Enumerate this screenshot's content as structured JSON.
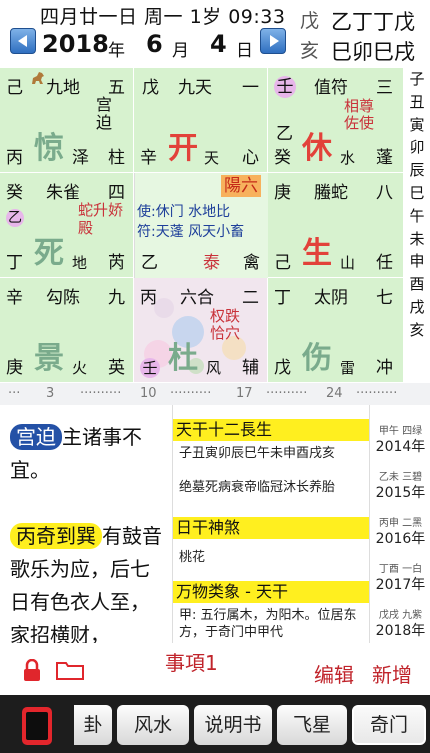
{
  "header": {
    "lunar_line": "四月廿一日 周一 1岁 09:33",
    "year": "2018",
    "year_unit": "年",
    "month": "6",
    "month_unit": "月",
    "day": "4",
    "day_unit": "日",
    "gz_top_label": "戊",
    "gz_top_value": "乙丁丁戊",
    "gz_bot_label": "亥",
    "gz_bot_value": "巳卯巳戌"
  },
  "palaces": {
    "p1": {
      "a": "己",
      "b": "九地",
      "c": "五",
      "note": "宫迫",
      "big": "惊",
      "d": "丙",
      "e": "泽",
      "f": "柱"
    },
    "p2": {
      "a": "戊",
      "b": "九天",
      "c": "一",
      "big": "开",
      "d": "辛",
      "e": "天",
      "f": "心"
    },
    "p3": {
      "a": "壬",
      "b": "值符",
      "c": "三",
      "note": "相尊佐使",
      "a2": "乙",
      "big": "休",
      "d": "癸",
      "e": "水",
      "f": "蓬"
    },
    "p4": {
      "a": "癸",
      "b": "朱雀",
      "c": "四",
      "a2": "乙",
      "note": "蛇升娇殿",
      "big": "死",
      "d": "丁",
      "e": "地",
      "f": "芮"
    },
    "p5": {
      "tag": "陽六",
      "l1": "使:休门  水地比",
      "l2": "符:天蓬  风天小畜",
      "l3": "乙",
      "l4": "泰",
      "l5": "禽"
    },
    "p6": {
      "a": "庚",
      "b": "螣蛇",
      "c": "八",
      "big": "生",
      "d": "己",
      "e": "山",
      "f": "任"
    },
    "p7": {
      "a": "辛",
      "b": "勾陈",
      "c": "九",
      "big": "景",
      "d": "庚",
      "e": "火",
      "f": "英"
    },
    "p8": {
      "a": "丙",
      "b": "六合",
      "c": "二",
      "note": "权跌恰穴",
      "big": "杜",
      "d": "壬",
      "e": "风",
      "f": "辅"
    },
    "p9": {
      "a": "丁",
      "b": "太阴",
      "c": "七",
      "big": "伤",
      "d": "戊",
      "e": "雷",
      "f": "冲"
    }
  },
  "side_hours": [
    "子",
    "丑",
    "寅",
    "卯",
    "辰",
    "巳",
    "午",
    "未",
    "申",
    "酉",
    "戌",
    "亥"
  ],
  "scale": [
    "3",
    "10",
    "17",
    "24"
  ],
  "left_panel": {
    "tag1": "宫迫",
    "text1": "主诸事不宜。",
    "tag2": "丙奇到巽",
    "text2": "有鼓音歌乐为应，后七日有色衣人至，家招横财，"
  },
  "mid_panel": {
    "h1": "天干十二長生",
    "b1": "子丑寅卯辰巳午未申酉戌亥",
    "b1b": "绝墓死病衰帝临冠沐长养胎",
    "h2": "日干神煞",
    "b2": "桃花",
    "h3": "万物类象 - 天干",
    "b3": "甲: 五行属木，为阳木。位居东方，于奇门中甲代"
  },
  "years": [
    {
      "s": "甲午 四绿",
      "y": "2014年"
    },
    {
      "s": "乙未 三碧",
      "y": "2015年"
    },
    {
      "s": "丙申 二黑",
      "y": "2016年"
    },
    {
      "s": "丁酉 一白",
      "y": "2017年"
    },
    {
      "s": "戊戌 九紫",
      "y": "2018年"
    }
  ],
  "actions": {
    "item": "事項1",
    "edit": "编辑",
    "add": "新增"
  },
  "tabs": [
    "卦",
    "风水",
    "说明书",
    "飞星",
    "奇门"
  ],
  "colors": {
    "palace": "#d7f2cf",
    "highlight": "#ffef1f",
    "accent": "#c0242b",
    "tabbar": "#1d1d1d"
  }
}
